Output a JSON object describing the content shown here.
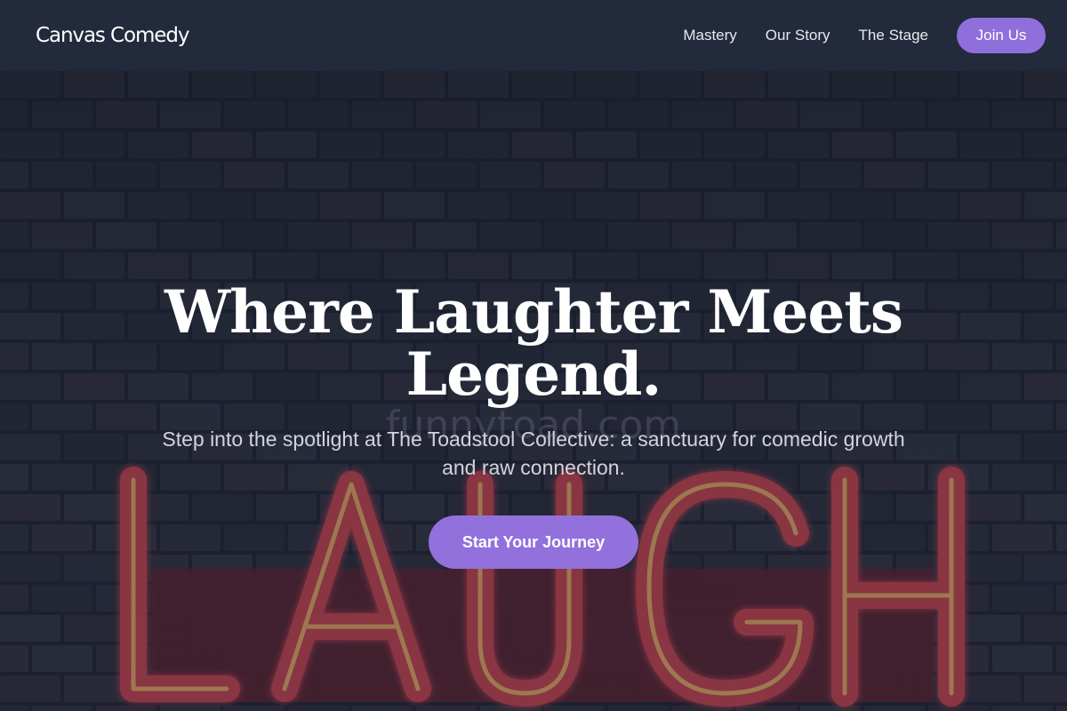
{
  "header": {
    "brand": "Canvas Comedy",
    "nav": [
      "Mastery",
      "Our Story",
      "The Stage"
    ],
    "join_label": "Join Us"
  },
  "hero": {
    "title": "Where Laughter Meets Legend.",
    "subtitle": "Step into the spotlight at The Toadstool Collective: a sanctuary for comedic growth and raw connection.",
    "cta_label": "Start Your Journey",
    "sign_text": "LAUGH",
    "watermark": "funnytoad.com"
  },
  "colors": {
    "header_bg": "#222a3c",
    "accent": "#8f6fdb",
    "neon": "#d94a5c"
  }
}
